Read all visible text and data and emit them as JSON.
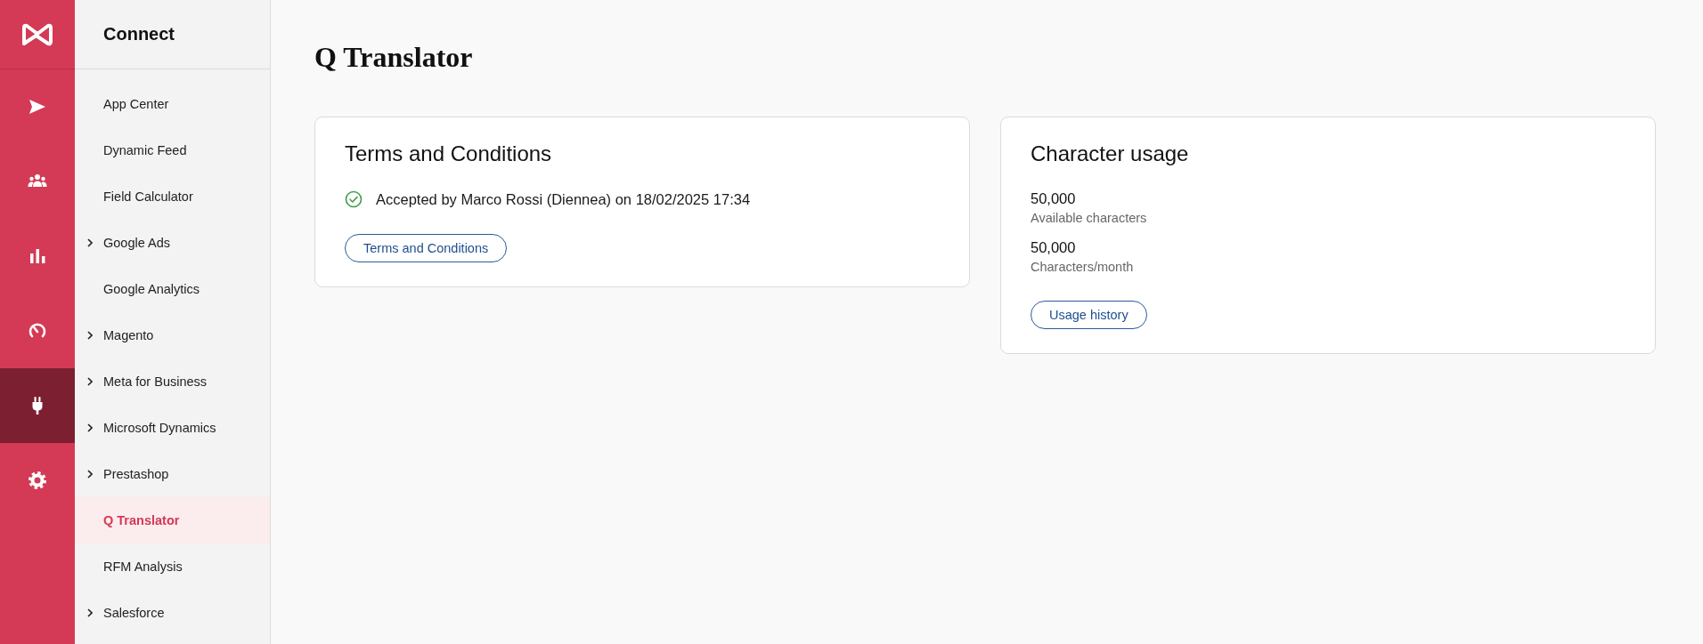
{
  "rail": {
    "items": [
      {
        "selected": false
      },
      {
        "selected": false
      },
      {
        "selected": false
      },
      {
        "selected": false
      },
      {
        "selected": true
      },
      {
        "selected": false
      }
    ]
  },
  "sidebar": {
    "title": "Connect",
    "items": [
      {
        "label": "App Center",
        "expandable": false,
        "selected": false
      },
      {
        "label": "Dynamic Feed",
        "expandable": false,
        "selected": false
      },
      {
        "label": "Field Calculator",
        "expandable": false,
        "selected": false
      },
      {
        "label": "Google Ads",
        "expandable": true,
        "selected": false
      },
      {
        "label": "Google Analytics",
        "expandable": false,
        "selected": false
      },
      {
        "label": "Magento",
        "expandable": true,
        "selected": false
      },
      {
        "label": "Meta for Business",
        "expandable": true,
        "selected": false
      },
      {
        "label": "Microsoft Dynamics",
        "expandable": true,
        "selected": false
      },
      {
        "label": "Prestashop",
        "expandable": true,
        "selected": false
      },
      {
        "label": "Q Translator",
        "expandable": false,
        "selected": true
      },
      {
        "label": "RFM Analysis",
        "expandable": false,
        "selected": false
      },
      {
        "label": "Salesforce",
        "expandable": true,
        "selected": false
      }
    ]
  },
  "page_title": "Q Translator",
  "terms_card": {
    "title": "Terms and Conditions",
    "status": "Accepted by Marco Rossi (Diennea) on 18/02/2025 17:34",
    "button": "Terms and Conditions"
  },
  "usage_card": {
    "title": "Character usage",
    "stats": [
      {
        "value": "50,000",
        "label": "Available characters"
      },
      {
        "value": "50,000",
        "label": "Characters/month"
      }
    ],
    "button": "Usage history"
  }
}
